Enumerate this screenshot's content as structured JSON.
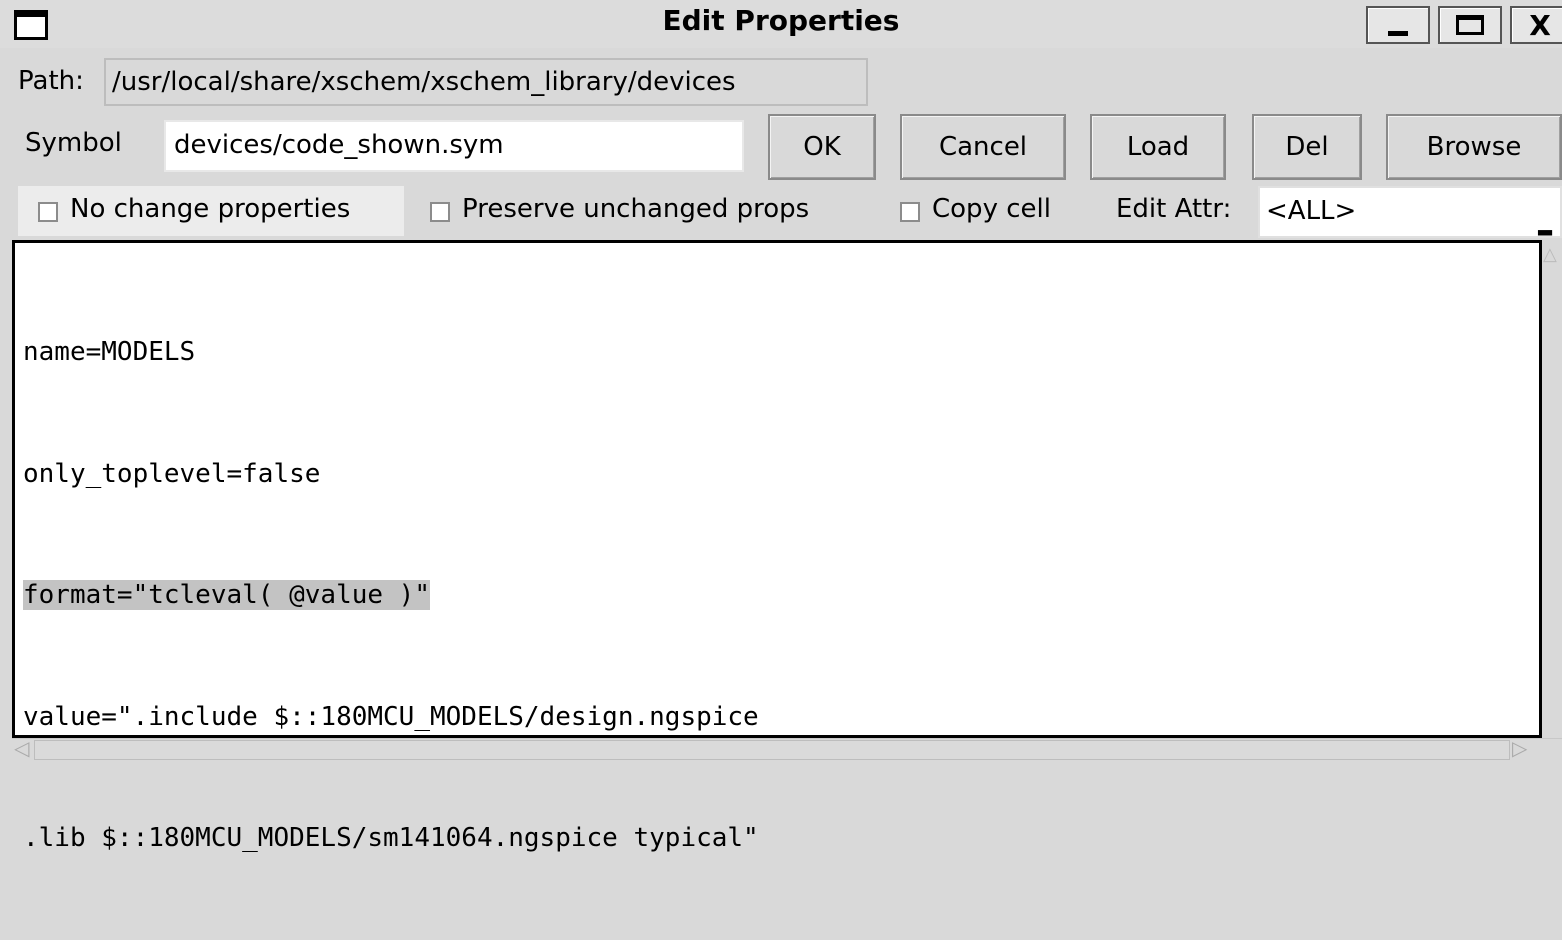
{
  "window": {
    "title": "Edit Properties",
    "icon": "window-icon",
    "controls": [
      "minimize-icon",
      "maximize-icon",
      "close-icon"
    ],
    "close_glyph": "X"
  },
  "path": {
    "label": "Path:",
    "value": "/usr/local/share/xschem/xschem_library/devices"
  },
  "symbol": {
    "label": "Symbol",
    "value": "devices/code_shown.sym"
  },
  "buttons": {
    "ok": "OK",
    "cancel": "Cancel",
    "load": "Load",
    "del": "Del",
    "browse": "Browse"
  },
  "options": {
    "no_change": {
      "label": "No change properties",
      "checked": false
    },
    "preserve": {
      "label": "Preserve unchanged props",
      "checked": false
    },
    "copy_cell": {
      "label": "Copy cell",
      "checked": false
    },
    "edit_attr_label": "Edit Attr:",
    "edit_attr_value": "<ALL>"
  },
  "editor": {
    "lines": [
      "name=MODELS",
      "only_toplevel=false",
      "format=\"tcleval( @value )\"",
      "value=\".include $::180MCU_MODELS/design.ngspice",
      ".lib $::180MCU_MODELS/sm141064.ngspice typical\""
    ],
    "highlighted_line": 2
  },
  "colors": {
    "window_bg": "#d9d9d9",
    "editor_bg": "#ffffff",
    "selection": "#c3c3c3"
  }
}
